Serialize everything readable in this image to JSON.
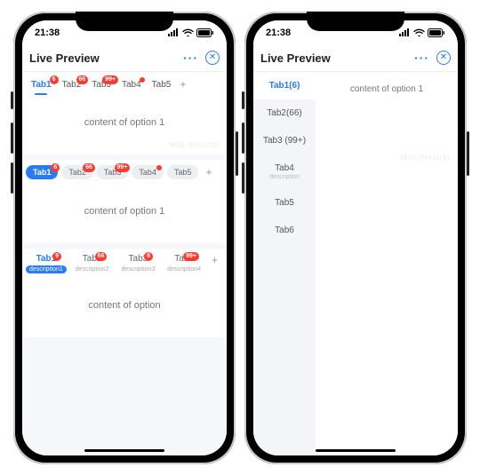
{
  "status": {
    "time": "21:38"
  },
  "header": {
    "title": "Live Preview"
  },
  "watermark": "MOLINKUISI",
  "phone1": {
    "sec1": {
      "tabs": [
        {
          "label": "Tab1",
          "badge": "6",
          "active": true
        },
        {
          "label": "Tab2",
          "badge": "66"
        },
        {
          "label": "Tab3",
          "badge": "99+"
        },
        {
          "label": "Tab4",
          "badgeDot": true
        },
        {
          "label": "Tab5"
        }
      ],
      "content": "content of option 1"
    },
    "sec2": {
      "tabs": [
        {
          "label": "Tab1",
          "badge": "6",
          "active": true
        },
        {
          "label": "Tab2",
          "badge": "66"
        },
        {
          "label": "Tab3",
          "badge": "99+"
        },
        {
          "label": "Tab4",
          "badgeDot": true
        },
        {
          "label": "Tab5"
        }
      ],
      "content": "content of option 1"
    },
    "sec3": {
      "tabs": [
        {
          "label": "Tab1",
          "badge": "9",
          "desc": "description1",
          "active": true
        },
        {
          "label": "Tab2",
          "badge": "66",
          "desc": "description2"
        },
        {
          "label": "Tab3",
          "badge": "6",
          "desc": "description3"
        },
        {
          "label": "Tab4",
          "badge": "99+",
          "desc": "description4"
        }
      ],
      "content": "content of  option"
    }
  },
  "phone2": {
    "tabs": [
      {
        "label": "Tab1(6)",
        "active": true
      },
      {
        "label": "Tab2(66)"
      },
      {
        "label": "Tab3 (99+)"
      },
      {
        "label": "Tab4",
        "desc": "description"
      },
      {
        "label": "Tab5"
      },
      {
        "label": "Tab6"
      }
    ],
    "content": "content of option 1"
  }
}
